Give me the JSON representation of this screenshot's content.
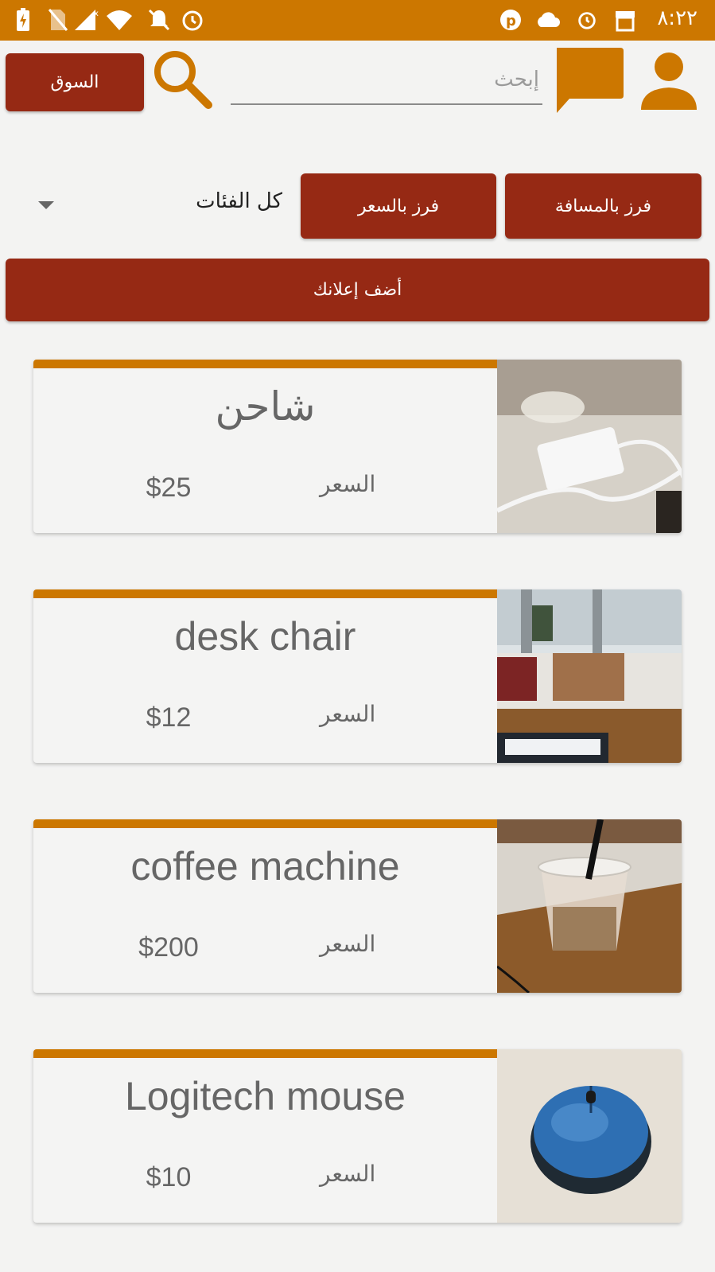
{
  "status_bar": {
    "time": "٨:٢٢",
    "icons": [
      "battery-charging-icon",
      "no-sim-icon",
      "signal-icon",
      "wifi-icon",
      "notifications-off-icon",
      "alarm-icon",
      "parking-app-icon",
      "cloud-icon",
      "alarm-icon",
      "store-icon"
    ]
  },
  "header": {
    "market_label": "السوق",
    "search_placeholder": "إبحث",
    "icons": [
      "search-icon",
      "chat-icon",
      "profile-icon"
    ]
  },
  "filters": {
    "sort_distance_label": "فرز بالمسافة",
    "sort_price_label": "فرز بالسعر",
    "category_selected": "كل الفئات"
  },
  "add_ad_label": "أضف إعلانك",
  "listings": [
    {
      "title": "شاحن",
      "price_label": "السعر",
      "price": "$25"
    },
    {
      "title": "desk chair",
      "price_label": "السعر",
      "price": "$12"
    },
    {
      "title": "coffee machine",
      "price_label": "السعر",
      "price": "$200"
    },
    {
      "title": "Logitech mouse",
      "price_label": "السعر",
      "price": "$10"
    }
  ],
  "colors": {
    "accent": "#cc7700",
    "button": "#962914",
    "background": "#f3f3f2"
  }
}
